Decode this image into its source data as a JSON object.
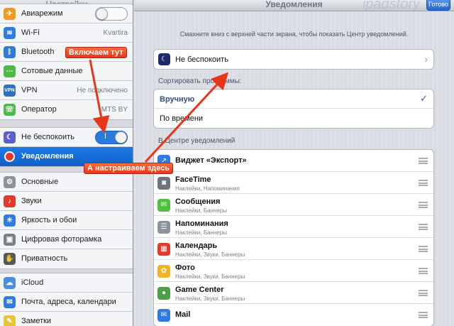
{
  "sidebar": {
    "title": "Настройки",
    "groups": [
      [
        {
          "label": "Авиарежим",
          "icon": "airplane-icon",
          "color": "#f29a1c",
          "toggle": "off"
        },
        {
          "label": "Wi-Fi",
          "icon": "wifi-icon",
          "color": "#2f7be2",
          "value": "Kvartira"
        },
        {
          "label": "Bluetooth",
          "icon": "bluetooth-icon",
          "color": "#2f7be2",
          "value": ""
        },
        {
          "label": "Сотовые данные",
          "icon": "cellular-icon",
          "color": "#4fb94a",
          "value": ""
        },
        {
          "label": "VPN",
          "icon": "vpn-icon",
          "color": "#2f6fc4",
          "value": "Не подключено"
        },
        {
          "label": "Оператор",
          "icon": "carrier-icon",
          "color": "#4fb94a",
          "value": "MTS BY"
        }
      ],
      [
        {
          "label": "Не беспокоить",
          "icon": "moon-icon",
          "color": "#5a5fd1",
          "toggle": "on"
        },
        {
          "label": "Уведомления",
          "icon": "notifications-icon",
          "color": "#e33a2b",
          "selected": true
        }
      ],
      [
        {
          "label": "Основные",
          "icon": "gear-icon",
          "color": "#8e939b"
        },
        {
          "label": "Звуки",
          "icon": "speaker-icon",
          "color": "#e33a2b"
        },
        {
          "label": "Яркость и обои",
          "icon": "brightness-icon",
          "color": "#2f7be2"
        },
        {
          "label": "Цифровая фоторамка",
          "icon": "photo-frame-icon",
          "color": "#7b7f86"
        },
        {
          "label": "Приватность",
          "icon": "privacy-hand-icon",
          "color": "#55595f"
        }
      ],
      [
        {
          "label": "iCloud",
          "icon": "cloud-icon",
          "color": "#4a90e2"
        },
        {
          "label": "Почта, адреса, календари",
          "icon": "mail-icon",
          "color": "#2f7be2"
        },
        {
          "label": "Заметки",
          "icon": "notes-icon",
          "color": "#e7c437"
        }
      ]
    ]
  },
  "main": {
    "title": "Уведомления",
    "watermark": "ipadstory",
    "done_label": "Готово",
    "hint": "Смахните вниз с верхней части экрана, чтобы показать Центр уведомлений.",
    "dnd_label": "Не беспокоить",
    "sort_label": "Сортировать программы:",
    "sort_options": [
      {
        "label": "Вручную",
        "checked": true
      },
      {
        "label": "По времени",
        "checked": false
      }
    ],
    "center_label": "В Центре уведомлений",
    "apps": [
      {
        "name": "Виджет «Экспорт»",
        "sub": "",
        "icon": "share-icon",
        "color": "#2f7be2"
      },
      {
        "name": "FaceTime",
        "sub": "Наклейки, Напоминания",
        "icon": "facetime-icon",
        "color": "#6f747c"
      },
      {
        "name": "Сообщения",
        "sub": "Наклейки, Баннеры",
        "icon": "messages-icon",
        "color": "#4fc13f"
      },
      {
        "name": "Напоминания",
        "sub": "Наклейки, Баннеры",
        "icon": "reminders-icon",
        "color": "#8e939b"
      },
      {
        "name": "Календарь",
        "sub": "Наклейки, Звуки, Баннеры",
        "icon": "calendar-icon",
        "color": "#e33a2b"
      },
      {
        "name": "Фото",
        "sub": "Наклейки, Звуки, Баннеры",
        "icon": "photos-icon",
        "color": "#f0b323"
      },
      {
        "name": "Game Center",
        "sub": "Наклейки, Звуки, Баннеры",
        "icon": "game-center-icon",
        "color": "#4aa042"
      },
      {
        "name": "Mail",
        "sub": "",
        "icon": "mail-icon",
        "color": "#2f7be2"
      }
    ]
  },
  "annotations": {
    "enable_here": "Включаем тут",
    "configure_here": "А настраиваем здесь",
    "arrow_color": "#e8361a"
  }
}
